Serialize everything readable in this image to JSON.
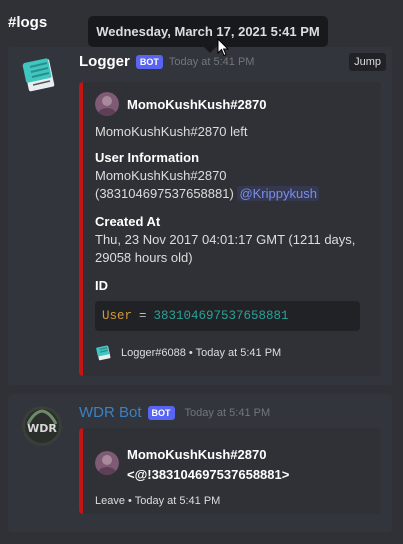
{
  "channel": {
    "title": "#logs"
  },
  "tooltip": {
    "text": "Wednesday, March 17, 2021 5:41 PM"
  },
  "messages": [
    {
      "author": "Logger",
      "bot_tag": "BOT",
      "timestamp": "Today at 5:41 PM",
      "jump_label": "Jump",
      "embed": {
        "author_name": "MomoKushKush#2870",
        "description": "MomoKushKush#2870 left",
        "fields": [
          {
            "name": "User Information",
            "value_line1": "MomoKushKush#2870",
            "value_line2": "(383104697537658881)",
            "mention": "@Krippykush"
          },
          {
            "name": "Created At",
            "value_line1": "Thu, 23 Nov 2017 04:01:17 GMT (1211 days,",
            "value_line2": "29058 hours old)"
          },
          {
            "name": "ID",
            "code_key": "User",
            "code_eq": "=",
            "code_value": "383104697537658881"
          }
        ],
        "footer": "Logger#6088 • Today at 5:41 PM"
      }
    },
    {
      "author": "WDR Bot",
      "bot_tag": "BOT",
      "timestamp": "Today at 5:41 PM",
      "avatar_text": "WDR",
      "embed": {
        "author_line1": "MomoKushKush#2870",
        "author_line2": "<@!383104697537658881>",
        "footer": "Leave • Today at 5:41 PM"
      }
    }
  ],
  "colors": {
    "embed_border": "#c41414",
    "bot_tag": "#5865f2",
    "mention": "#7a8ee5",
    "wdr_name": "#3b82c4"
  }
}
